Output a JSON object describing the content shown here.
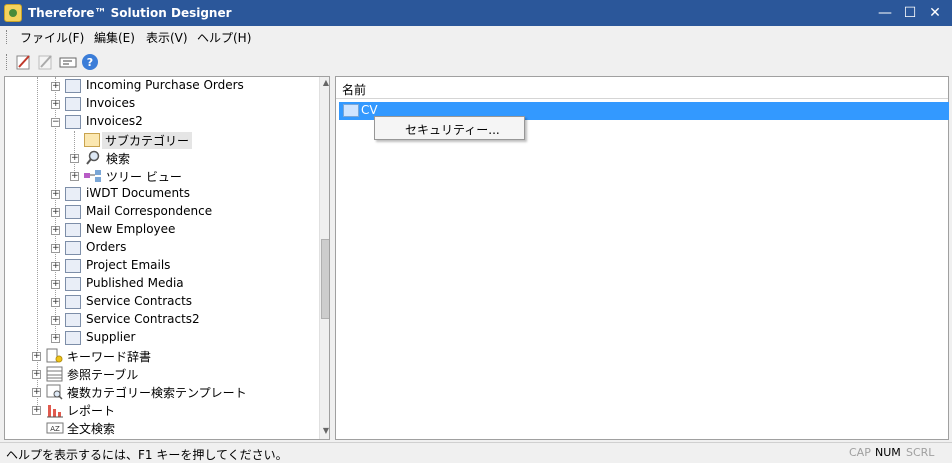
{
  "window": {
    "title": "Therefore™ Solution Designer"
  },
  "menubar": {
    "items": [
      "ファイル(F)",
      "編集(E)",
      "表示(V)",
      "ヘルプ(H)"
    ]
  },
  "tree": {
    "items": [
      {
        "label": "Incoming Purchase Orders",
        "icon": "folder-icon"
      },
      {
        "label": "Invoices",
        "icon": "folder-icon"
      },
      {
        "label": "Invoices2",
        "icon": "folder-icon"
      },
      {
        "label": "サブカテゴリー",
        "icon": "open-folder-icon"
      },
      {
        "label": "検索",
        "icon": "search-icon"
      },
      {
        "label": "ツリー ビュー",
        "icon": "tree-view-icon"
      },
      {
        "label": "iWDT Documents",
        "icon": "folder-icon"
      },
      {
        "label": "Mail Correspondence",
        "icon": "folder-icon"
      },
      {
        "label": "New Employee",
        "icon": "folder-icon"
      },
      {
        "label": "Orders",
        "icon": "folder-icon"
      },
      {
        "label": "Project Emails",
        "icon": "folder-icon"
      },
      {
        "label": "Published Media",
        "icon": "folder-icon"
      },
      {
        "label": "Service Contracts",
        "icon": "folder-icon"
      },
      {
        "label": "Service Contracts2",
        "icon": "folder-icon"
      },
      {
        "label": "Supplier",
        "icon": "folder-icon"
      },
      {
        "label": "キーワード辞書",
        "icon": "keyword-dictionary-icon"
      },
      {
        "label": "参照テーブル",
        "icon": "reference-table-icon"
      },
      {
        "label": "複数カテゴリー検索テンプレート",
        "icon": "search-template-icon"
      },
      {
        "label": "レポート",
        "icon": "report-chart-icon"
      },
      {
        "label": "全文検索",
        "icon": "full-text-search-icon"
      }
    ]
  },
  "list": {
    "column_header": "名前",
    "rows": [
      {
        "label": "CV",
        "icon": "folder-icon"
      }
    ]
  },
  "context_menu": {
    "items": [
      "セキュリティー..."
    ]
  },
  "statusbar": {
    "message": "ヘルプを表示するには、F1 キーを押してください。",
    "indicators": [
      {
        "label": "CAP",
        "active": false
      },
      {
        "label": "NUM",
        "active": true
      },
      {
        "label": "SCRL",
        "active": false
      }
    ]
  },
  "colors": {
    "titlebar": "#2b579a",
    "selection": "#3399ff"
  }
}
